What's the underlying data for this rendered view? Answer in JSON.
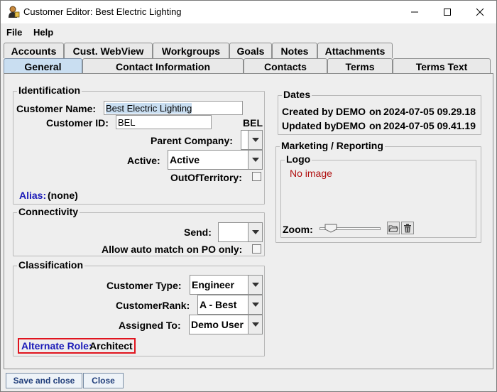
{
  "window": {
    "title": "Customer Editor: Best Electric Lighting",
    "icon": "customer-person-icon"
  },
  "menu": {
    "file": "File",
    "help": "Help"
  },
  "tabs_row1": [
    "Accounts",
    "Cust. WebView",
    "Workgroups",
    "Goals",
    "Notes",
    "Attachments"
  ],
  "tabs_row2": [
    "General",
    "Contact Information",
    "Contacts",
    "Terms",
    "Terms Text"
  ],
  "active_tab": "General",
  "identification": {
    "title": "Identification",
    "customer_name_label": "Customer Name:",
    "customer_name_value": "Best Electric Lighting",
    "customer_id_label": "Customer ID:",
    "customer_id_value": "BEL",
    "customer_id_suffix": "BEL",
    "parent_company_label": "Parent Company:",
    "parent_company_value": "",
    "active_label": "Active:",
    "active_value": "Active",
    "out_of_territory_label": "OutOfTerritory:",
    "out_of_territory_checked": false,
    "alias_label": "Alias:",
    "alias_value": "(none)"
  },
  "connectivity": {
    "title": "Connectivity",
    "send_label": "Send:",
    "send_value": "",
    "auto_match_label": "Allow auto match on PO only:",
    "auto_match_checked": false
  },
  "classification": {
    "title": "Classification",
    "customer_type_label": "Customer Type:",
    "customer_type_value": "Engineer",
    "customer_rank_label": "CustomerRank:",
    "customer_rank_value": "A - Best",
    "assigned_to_label": "Assigned To:",
    "assigned_to_value": "Demo User",
    "alternate_role_label": "Alternate Role:",
    "alternate_role_value": "Architect"
  },
  "dates": {
    "title": "Dates",
    "created_label": "Created by",
    "created_user": "DEMO",
    "created_on": "on",
    "created_date": "2024-07-05 09.29.18",
    "updated_label": "Updated by",
    "updated_user": "DEMO",
    "updated_on": "on",
    "updated_date": "2024-07-05 09.41.19"
  },
  "marketing": {
    "title": "Marketing / Reporting",
    "logo_title": "Logo",
    "no_image": "No image",
    "zoom_label": "Zoom:",
    "zoom_level": 0.1
  },
  "buttons": {
    "save_close": "Save and close",
    "close": "Close"
  },
  "colors": {
    "link_blue": "#1a1ab8",
    "highlight_red": "#e0141e",
    "no_image_red": "#b01010",
    "active_tab": "#c9def1",
    "field_selected": "#c9def1"
  }
}
